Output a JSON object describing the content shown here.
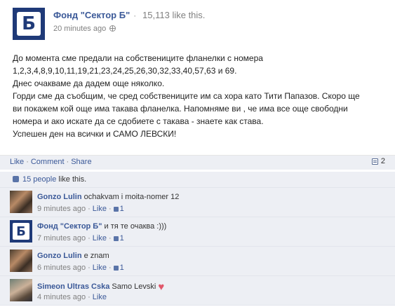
{
  "post": {
    "page_name": "Фонд \"Сектор Б\"",
    "separator": "·",
    "page_likes": "15,113 like this.",
    "time": "20 minutes ago",
    "body_lines": [
      "До момента сме предали на собствениците фланелки с номера",
      "1,2,3,4,8,9,10,11,19,21,23,24,25,26,30,32,33,40,57,63 и 69.",
      "Днес очакваме да дадем още няколко.",
      "Горди сме да съобщим, че сред собствениците им са хора като Тити Папазов. Скоро ще",
      "ви покажем кой още има такава фланелка. Напомняме ви , че има все още свободни",
      "номера и ако искате да се сдобиете с такава - знаете как става.",
      "Успешен ден на всички и САМО ЛЕВСКИ!"
    ]
  },
  "actions": {
    "like": "Like",
    "comment": "Comment",
    "share": "Share",
    "dot": "·",
    "comment_count": "2"
  },
  "likes": {
    "people_link": "15 people",
    "suffix": " like this."
  },
  "comments": [
    {
      "author": "Gonzo Lulin",
      "text": "ochakvam i moita-nomer 12",
      "time": "9 minutes ago",
      "like": "Like",
      "like_count": "1",
      "heart": false
    },
    {
      "author": "Фонд \"Сектор Б\"",
      "text": "и тя те очаква :)))",
      "time": "7 minutes ago",
      "like": "Like",
      "like_count": "1",
      "heart": false
    },
    {
      "author": "Gonzo Lulin",
      "text": "е znam",
      "time": "6 minutes ago",
      "like": "Like",
      "like_count": "1",
      "heart": false
    },
    {
      "author": "Simeon Ultras Cska",
      "text": "Samo Levski",
      "time": "4 minutes ago",
      "like": "Like",
      "like_count": "",
      "heart": true
    }
  ],
  "logo_letter": "Б",
  "colors": {
    "link": "#3b5998",
    "panel": "#edeff4",
    "brand": "#1f3a78",
    "heart": "#e0576a"
  }
}
